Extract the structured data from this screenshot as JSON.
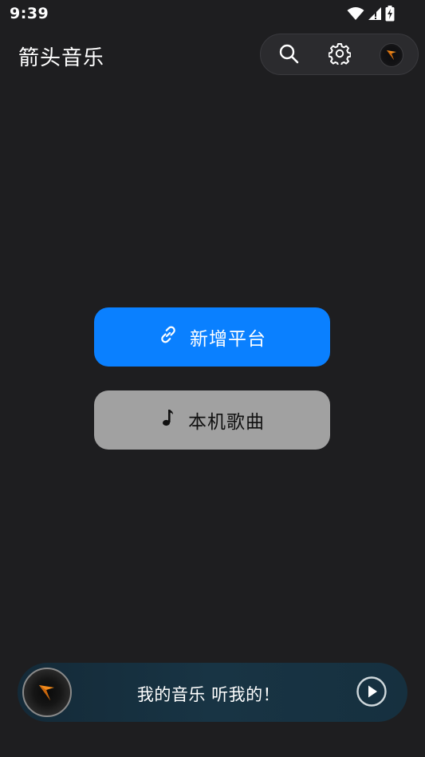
{
  "status_bar": {
    "time": "9:39",
    "icons": [
      "wifi-icon",
      "cellular-signal-icon",
      "battery-charging-icon"
    ]
  },
  "app_bar": {
    "title": "箭头音乐",
    "actions": [
      "search-icon",
      "gear-icon",
      "app-logo-avatar"
    ]
  },
  "main": {
    "add_platform": {
      "label": "新增平台",
      "icon": "link-icon",
      "color": "#0a80ff"
    },
    "local_songs": {
      "label": "本机歌曲",
      "icon": "music-note-icon",
      "color": "#a1a1a1"
    }
  },
  "player": {
    "title": "我的音乐 听我的！",
    "disc_icon": "app-logo-disc",
    "play_icon": "play-circle-icon",
    "background": "#183444"
  },
  "colors": {
    "background": "#1e1e20",
    "accent": "#0a80ff",
    "logo_orange": "#f08a1c"
  }
}
